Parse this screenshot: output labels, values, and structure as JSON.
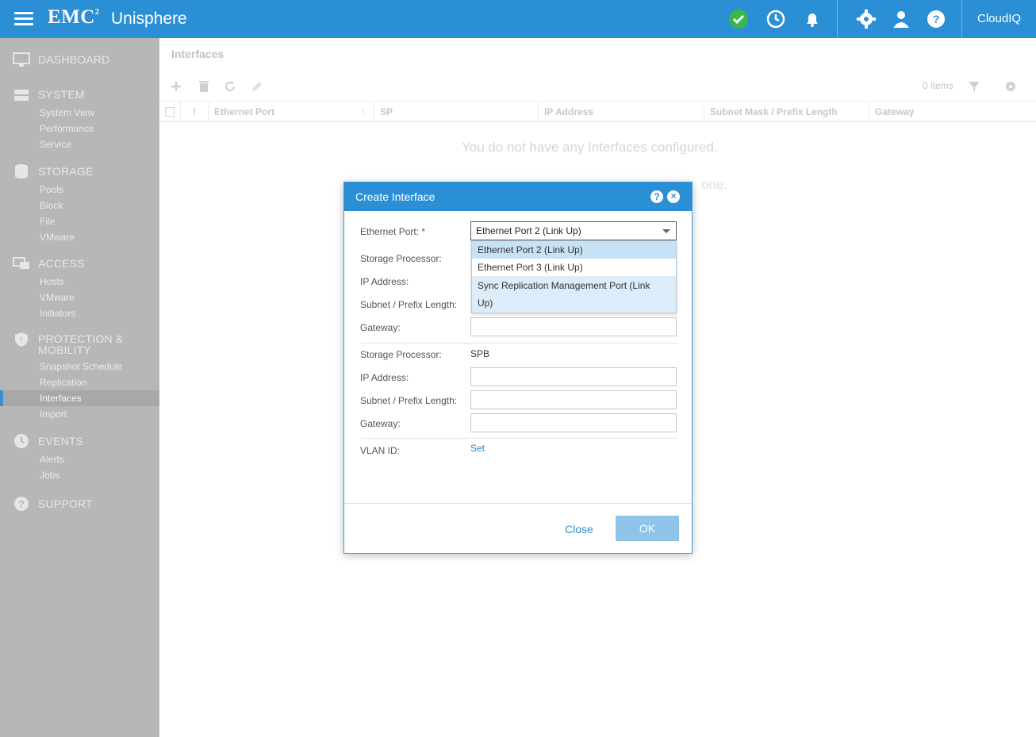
{
  "app": {
    "brand": "EMC",
    "brand_sup": "2",
    "product": "Unisphere",
    "cloudiq": "CloudIQ"
  },
  "header_icons": [
    "status-ok-icon",
    "jobs-clock-icon",
    "alerts-bell-icon",
    "settings-gear-icon",
    "user-icon",
    "help-icon"
  ],
  "sidebar": {
    "sections": [
      {
        "title": "DASHBOARD",
        "icon": "dashboard-icon",
        "items": []
      },
      {
        "title": "SYSTEM",
        "icon": "system-icon",
        "items": [
          "System View",
          "Performance",
          "Service"
        ]
      },
      {
        "title": "STORAGE",
        "icon": "storage-icon",
        "items": [
          "Pools",
          "Block",
          "File",
          "VMware"
        ]
      },
      {
        "title": "ACCESS",
        "icon": "access-icon",
        "items": [
          "Hosts",
          "VMware",
          "Initiators"
        ]
      },
      {
        "title": "PROTECTION &",
        "title2": "MOBILITY",
        "icon": "shield-icon",
        "items": [
          "Snapshot Schedule",
          "Replication",
          "Interfaces",
          "Import"
        ]
      },
      {
        "title": "EVENTS",
        "icon": "events-icon",
        "items": [
          "Alerts",
          "Jobs"
        ]
      },
      {
        "title": "SUPPORT",
        "icon": "support-icon",
        "items": []
      }
    ],
    "active_item": "Interfaces"
  },
  "main": {
    "title": "Interfaces",
    "items_count": "0 items",
    "columns": [
      "!",
      "Ethernet Port",
      "SP",
      "IP Address",
      "Subnet Mask / Prefix Length",
      "Gateway"
    ],
    "empty_message": "You do not have any Interfaces configured.",
    "empty_hint_end": "one."
  },
  "dialog": {
    "title": "Create Interface",
    "help": "?",
    "close_x": "×",
    "fields": {
      "ethernet_port_label": "Ethernet Port:",
      "required_mark": "*",
      "ethernet_port_value": "Ethernet Port 2 (Link Up)",
      "sp_a_label": "Storage Processor:",
      "ip_a_label": "IP Address:",
      "subnet_a_label": "Subnet / Prefix Length:",
      "gateway_a_label": "Gateway:",
      "sp_b_label": "Storage Processor:",
      "sp_b_value": "SPB",
      "ip_b_label": "IP Address:",
      "subnet_b_label": "Subnet / Prefix Length:",
      "gateway_b_label": "Gateway:",
      "vlan_label": "VLAN ID:",
      "vlan_link": "Set"
    },
    "dropdown_options": [
      "Ethernet Port 2 (Link Up)",
      "Ethernet Port 3 (Link Up)",
      "Sync Replication Management Port (Link",
      "Up)"
    ],
    "buttons": {
      "close": "Close",
      "ok": "OK"
    }
  },
  "colors": {
    "accent": "#2b8fd6",
    "sidebar": "#b7b7b7",
    "ok_green": "#3cb54a"
  }
}
